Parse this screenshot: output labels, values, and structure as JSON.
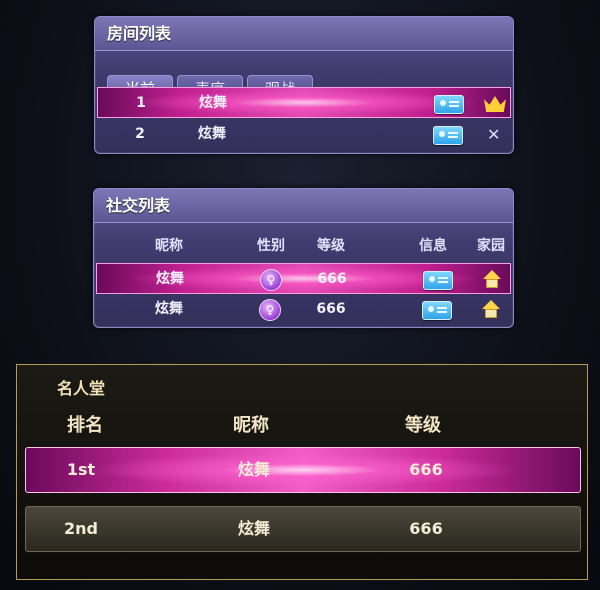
{
  "room_list": {
    "title": "房间列表",
    "tabs": [
      {
        "label": "当前",
        "active": true
      },
      {
        "label": "麦序",
        "active": false
      },
      {
        "label": "观战",
        "active": false
      }
    ],
    "rows": [
      {
        "index": "1",
        "name": "炫舞",
        "icons": [
          "message-icon",
          "crown-icon"
        ],
        "selected": true
      },
      {
        "index": "2",
        "name": "炫舞",
        "icons": [
          "message-icon",
          "close-icon"
        ],
        "selected": false
      }
    ],
    "close_symbol": "✕"
  },
  "social_list": {
    "title": "社交列表",
    "headers": {
      "nickname": "昵称",
      "gender": "性别",
      "level": "等级",
      "info": "信息",
      "family": "家园"
    },
    "rows": [
      {
        "name": "炫舞",
        "gender_icon": "female-icon",
        "level": "666",
        "selected": true
      },
      {
        "name": "炫舞",
        "gender_icon": "female-icon",
        "level": "666",
        "selected": false
      }
    ],
    "gender_symbol": "♀"
  },
  "hall_of_fame": {
    "title": "名人堂",
    "headers": {
      "rank": "排名",
      "nickname": "昵称",
      "level": "等级"
    },
    "rows": [
      {
        "rank": "1st",
        "name": "炫舞",
        "level": "666"
      },
      {
        "rank": "2nd",
        "name": "炫舞",
        "level": "666"
      }
    ]
  },
  "colors": {
    "panel_purple": "#3f3b6e",
    "highlight_pink": "#e44bb4",
    "gold_border": "#b99b53",
    "crown_gold": "#ffcf3a",
    "message_blue": "#2ea3ea"
  }
}
